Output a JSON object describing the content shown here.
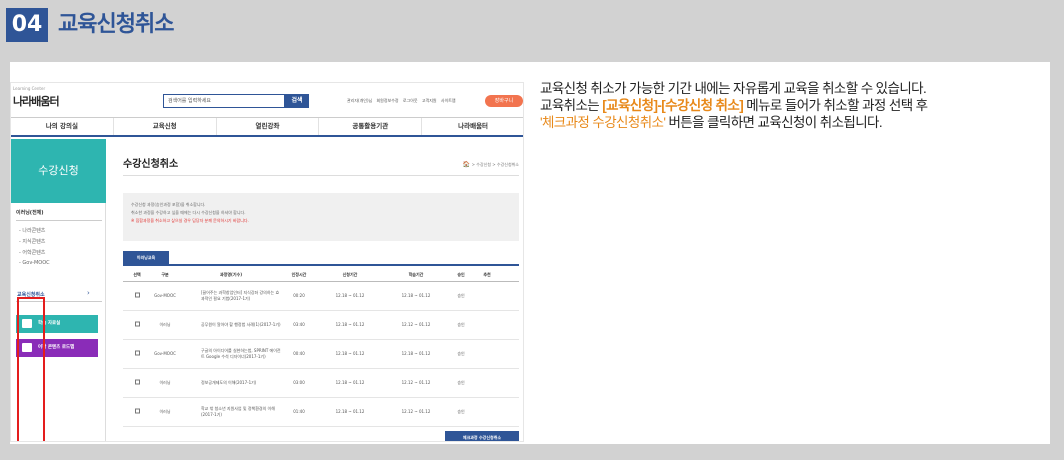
{
  "header": {
    "number": "04",
    "title": "교육신청취소"
  },
  "shot": {
    "logo_tagline": "Learning Center",
    "logo": "나라배움터",
    "search_placeholder": "검색어를 입력하세요",
    "search_button": "검색",
    "util_links": [
      "관리자(개인)님",
      "회원정보수정",
      "로그아웃",
      "고객지원",
      "사이트맵"
    ],
    "cart_button": "장바구니",
    "gnb": [
      "나의 강의실",
      "교육신청",
      "열린강좌",
      "공통활용기관",
      "나라배움터"
    ],
    "lnb": {
      "banner": "수강신청",
      "head": "이러닝(전체)",
      "subs": [
        "- 나라콘텐츠",
        "- 지식콘텐츠",
        "- 어학콘텐츠",
        "- Gov-MOOC"
      ],
      "selected": "교육신청취소",
      "selected_arrow": "›",
      "buttons": [
        {
          "label": "학습 자료실",
          "color": "#2eb5b0"
        },
        {
          "label": "어학 콘텐츠 로드맵",
          "color": "#8a2cb8"
        }
      ]
    },
    "main": {
      "title": "수강신청취소",
      "breadcrumb": "> 수강신청 > 수강신청취소",
      "home_icon": "🏠",
      "notice": [
        "수강신청 과정(승인과정 포함)을 취소합니다.",
        "취소한 과정을 수강하고 싶을 때에는 다시 수강신청을 하셔야 합니다.",
        "※ 집합과정을 취소하고 싶으실 경우 담당자 분께 문의하시기 바랍니다."
      ],
      "tab": "이러닝교육",
      "table_headers": [
        "선택",
        "구분",
        "과정명(기수)",
        "인정시간",
        "신청기간",
        "학습기간",
        "승인",
        "추천"
      ],
      "rows": [
        {
          "type": "Gov-MOOC",
          "name": "[끌어주는 과학창업인터] 지식강좌 강의하는 효과적인 필요 기법(2017-1기)",
          "hours": "00:20",
          "apply": "12.18 ~ 01.12",
          "study": "12.18 ~ 01.12",
          "approve": "승인"
        },
        {
          "type": "이러닝",
          "name": "공무원이 알아야 할 행정법 사례(1)(2017-1기)",
          "hours": "03:40",
          "apply": "12.18 ~ 01.12",
          "study": "12.12 ~ 01.12",
          "approve": "승인"
        },
        {
          "type": "Gov-MOOC",
          "name": "구글의 아이디어를 실현하는법, SPRINT 에이전트 Google 수석 디자이너(2017-1기)",
          "hours": "00:40",
          "apply": "12.18 ~ 01.12",
          "study": "12.18 ~ 01.12",
          "approve": "승인"
        },
        {
          "type": "이러닝",
          "name": "정보공개제도의 이해(2017-1기)",
          "hours": "03:00",
          "apply": "12.18 ~ 01.12",
          "study": "12.12 ~ 01.12",
          "approve": "승인"
        },
        {
          "type": "이러닝",
          "name": "학교 밖 청소년 지원사업 및 정책환경의 이해(2017-1기)",
          "hours": "01:40",
          "apply": "12.18 ~ 01.12",
          "study": "12.12 ~ 01.12",
          "approve": "승인"
        }
      ],
      "bottom_button": "체크과정 수강신청취소"
    }
  },
  "description": {
    "line1": "교육신청 취소가 가능한 기간 내에는 자유롭게 교육을 취소할 수 있습니다.",
    "line2_pre": "교육취소는 ",
    "line2_hl": "[교육신청]-[수강신청 취소]",
    "line2_post": " 메뉴로 들어가 취소할 과정 선택 후",
    "line3_hl": "'체크과정 수강신청취소'",
    "line3_post": " 버튼을 클릭하면 교육신청이 취소됩니다."
  }
}
